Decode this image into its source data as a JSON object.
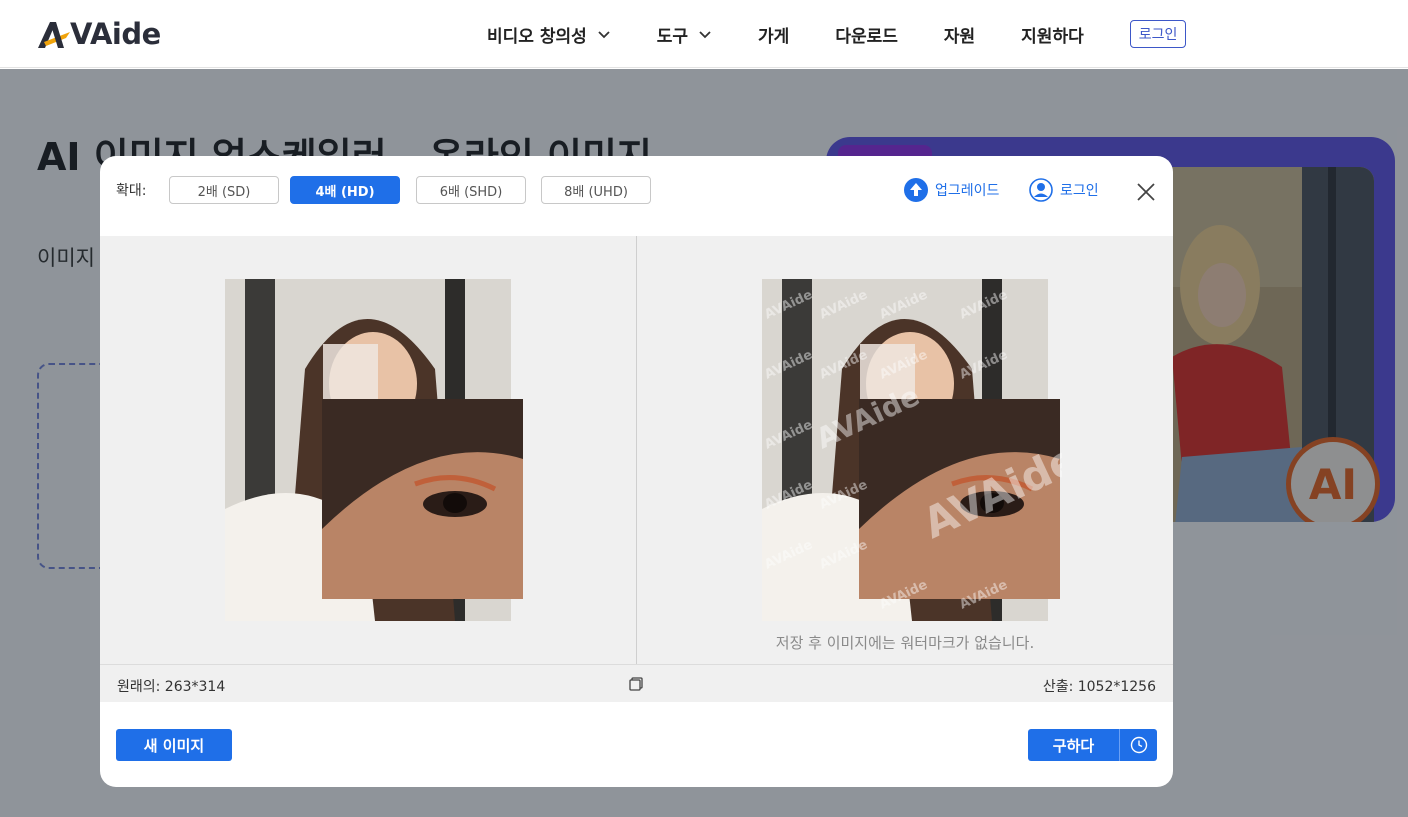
{
  "header": {
    "logo_text": "VAide",
    "nav": [
      {
        "label": "비디오 창의성",
        "dropdown": true
      },
      {
        "label": "도구",
        "dropdown": true
      },
      {
        "label": "가게",
        "dropdown": false
      },
      {
        "label": "다운로드",
        "dropdown": false
      },
      {
        "label": "자원",
        "dropdown": false
      },
      {
        "label": "지원하다",
        "dropdown": false
      }
    ],
    "login_label": "로그인"
  },
  "page": {
    "hero_title": "AI 이미지 업스케일러 - 온라인 이미지",
    "hero_subtitle": "이미지 미지를",
    "promo_badge": "AI"
  },
  "modal": {
    "zoom_label": "확대:",
    "zoom_options": [
      "2배 (SD)",
      "4배 (HD)",
      "6배 (SHD)",
      "8배 (UHD)"
    ],
    "zoom_selected": "4배 (HD)",
    "upgrade_label": "업그레이드",
    "login_label": "로그인",
    "watermark_note": "저장 후 이미지에는 워터마크가 없습니다.",
    "original_size": "원래의: 263*314",
    "output_size": "산출: 1052*1256",
    "new_image_label": "새 이미지",
    "save_label": "구하다",
    "watermark_text": "AVAide"
  },
  "colors": {
    "primary": "#1f6fe8",
    "promo_purple": "#5b4fe0",
    "ai_orange": "#e2601f"
  }
}
